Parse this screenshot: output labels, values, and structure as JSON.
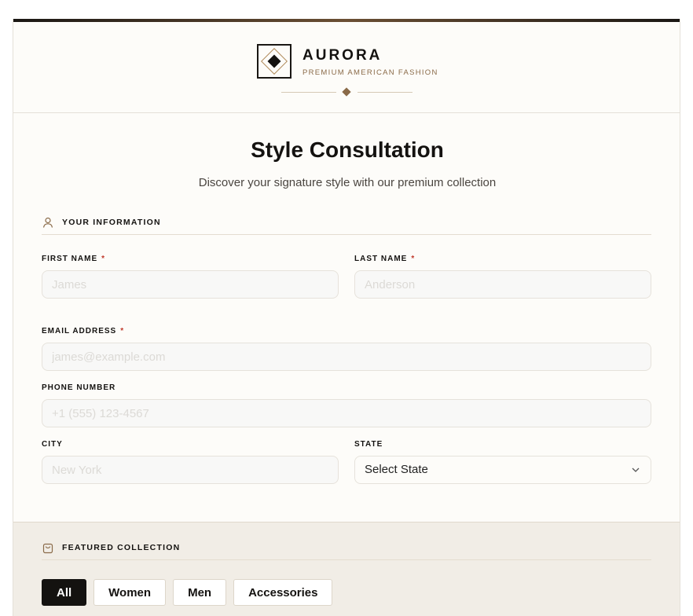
{
  "brand": {
    "name": "AURORA",
    "tagline": "PREMIUM AMERICAN FASHION"
  },
  "page": {
    "title": "Style Consultation",
    "subtitle": "Discover your signature style with our premium collection"
  },
  "sections": {
    "info": {
      "label": "YOUR INFORMATION",
      "icon": "user-icon"
    },
    "featured": {
      "label": "FEATURED COLLECTION",
      "icon": "shopping-bag-icon"
    }
  },
  "fields": {
    "first_name": {
      "label": "FIRST NAME",
      "required": "*",
      "placeholder": "James",
      "value": ""
    },
    "last_name": {
      "label": "LAST NAME",
      "required": "*",
      "placeholder": "Anderson",
      "value": ""
    },
    "email": {
      "label": "EMAIL ADDRESS",
      "required": "*",
      "placeholder": "james@example.com",
      "value": ""
    },
    "phone": {
      "label": "PHONE NUMBER",
      "placeholder": "+1 (555) 123-4567",
      "value": ""
    },
    "city": {
      "label": "CITY",
      "placeholder": "New York",
      "value": ""
    },
    "state": {
      "label": "STATE",
      "selected": "Select State"
    }
  },
  "collection_tabs": [
    {
      "label": "All",
      "active": true
    },
    {
      "label": "Women",
      "active": false
    },
    {
      "label": "Men",
      "active": false
    },
    {
      "label": "Accessories",
      "active": false
    }
  ],
  "colors": {
    "accent": "#8a6a48",
    "dark": "#141210",
    "required": "#c0392b"
  }
}
